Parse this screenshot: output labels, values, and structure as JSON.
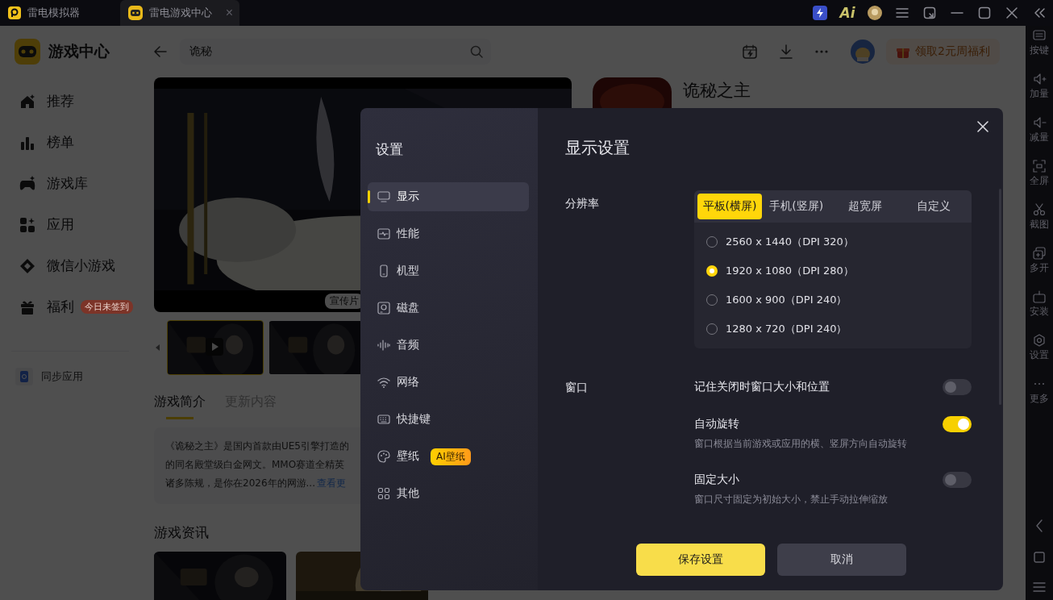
{
  "title_bar": {
    "tabs": [
      {
        "label": "雷电模拟器",
        "selected": false
      },
      {
        "label": "雷电游戏中心",
        "selected": true,
        "close": "×"
      }
    ],
    "ai_label": "Ai"
  },
  "sidebar": {
    "title": "游戏中心",
    "items": [
      {
        "label": "推荐"
      },
      {
        "label": "榜单"
      },
      {
        "label": "游戏库"
      },
      {
        "label": "应用"
      },
      {
        "label": "微信小游戏"
      },
      {
        "label": "福利",
        "badge": "今日未签到"
      }
    ],
    "sync_item": "同步应用"
  },
  "top_bar": {
    "search": {
      "value": "诡秘"
    },
    "promo": "领取2元周福利"
  },
  "game": {
    "title": "诡秘之主",
    "video_label": "宣传片",
    "thumbnails": [
      {
        "selected": true
      },
      {
        "selected": false
      }
    ],
    "tabs": [
      {
        "label": "游戏简介",
        "selected": true
      },
      {
        "label": "更新内容",
        "selected": false
      }
    ],
    "description": {
      "lines": [
        "《诡秘之主》是国内首款由UE5引擎打造的",
        "的同名殿堂级白金网文。MMO赛道全精英",
        "诸多陈规，是你在2026年的网游..."
      ],
      "more_link": "查看更"
    },
    "news_title": "游戏资讯"
  },
  "right_toolbar": {
    "items": [
      {
        "label": "按键"
      },
      {
        "label": "加量"
      },
      {
        "label": "减量"
      },
      {
        "label": "全屏"
      },
      {
        "label": "截图"
      },
      {
        "label": "多开"
      },
      {
        "label": "安装"
      },
      {
        "label": "设置"
      },
      {
        "label": "更多"
      }
    ]
  },
  "settings_dialog": {
    "title": "设置",
    "nav": [
      {
        "label": "显示",
        "selected": true
      },
      {
        "label": "性能",
        "selected": false
      },
      {
        "label": "机型",
        "selected": false
      },
      {
        "label": "磁盘",
        "selected": false
      },
      {
        "label": "音频",
        "selected": false
      },
      {
        "label": "网络",
        "selected": false
      },
      {
        "label": "快捷键",
        "selected": false
      },
      {
        "label": "壁纸",
        "selected": false,
        "badge": "AI壁纸"
      },
      {
        "label": "其他",
        "selected": false
      }
    ],
    "heading": "显示设置",
    "resolution": {
      "label": "分辨率",
      "tabs": [
        {
          "label": "平板(横屏)",
          "selected": true
        },
        {
          "label": "手机(竖屏)",
          "selected": false
        },
        {
          "label": "超宽屏",
          "selected": false
        },
        {
          "label": "自定义",
          "selected": false
        }
      ],
      "options": [
        {
          "label": "2560 x 1440（DPI 320）",
          "selected": false
        },
        {
          "label": "1920 x 1080（DPI 280）",
          "selected": true
        },
        {
          "label": "1600 x 900（DPI 240）",
          "selected": false
        },
        {
          "label": "1280 x 720（DPI 240）",
          "selected": false
        }
      ]
    },
    "window": {
      "label": "窗口",
      "toggles": [
        {
          "label": "记住关闭时窗口大小和位置",
          "on": false
        },
        {
          "label": "自动旋转",
          "on": true,
          "description": "窗口根据当前游戏或应用的横、竖屏方向自动旋转"
        },
        {
          "label": "固定大小",
          "on": false,
          "description": "窗口尺寸固定为初始大小，禁止手动拉伸缩放"
        }
      ]
    },
    "buttons": [
      {
        "label": "保存设置",
        "kind": "primary"
      },
      {
        "label": "取消",
        "kind": "secondary"
      }
    ]
  }
}
